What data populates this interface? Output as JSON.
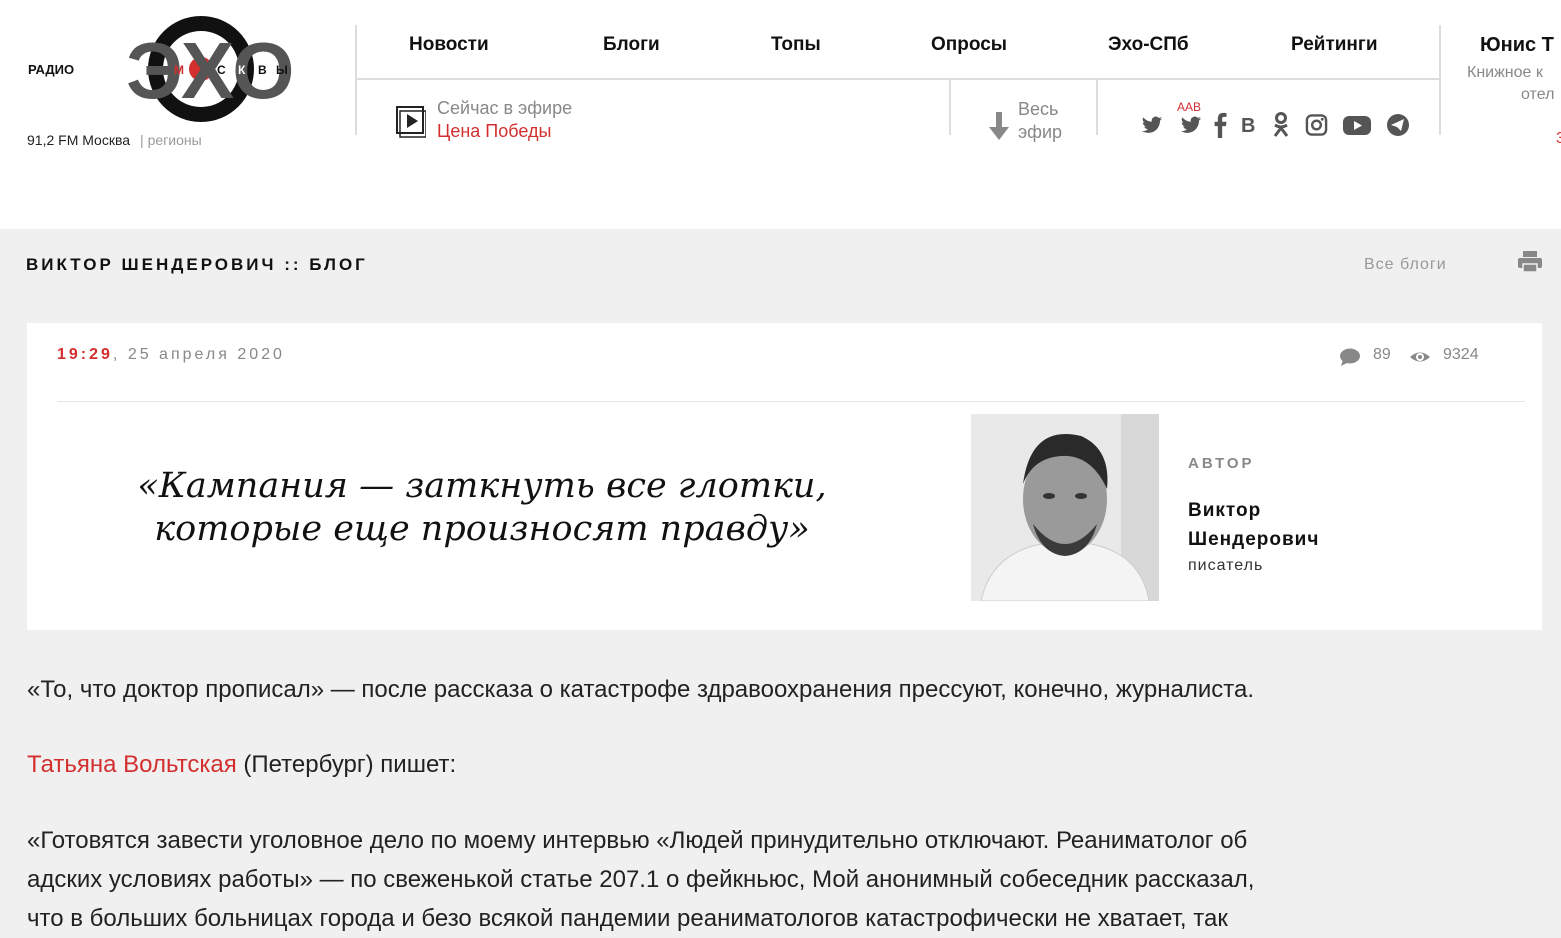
{
  "logo": {
    "text_left": "РАДИО",
    "text_right_1": "М",
    "text_right_2": "С",
    "text_right_3": "К",
    "text_right_4": "В",
    "text_right_5": "Ы",
    "main": "ЭХО"
  },
  "region": {
    "fm": "91,2 FM Москва",
    "regions": "регионы"
  },
  "nav": [
    {
      "label": "Новости"
    },
    {
      "label": "Блоги"
    },
    {
      "label": "Топы"
    },
    {
      "label": "Опросы"
    },
    {
      "label": "Эхо-СПб"
    },
    {
      "label": "Рейтинги"
    }
  ],
  "on_air": {
    "label": "Сейчас в эфире",
    "show": "Цена Победы"
  },
  "all_air": {
    "line1": "Весь",
    "line2": "эфир"
  },
  "social": {
    "aab_label": "AAB",
    "icons": [
      "twitter-icon",
      "twitter-aab-icon",
      "facebook-icon",
      "vk-icon",
      "odnoklassniki-icon",
      "instagram-icon",
      "youtube-icon",
      "telegram-icon"
    ]
  },
  "promo": {
    "name": "Юнис Т",
    "sub1": "Книжное к",
    "sub2": "отел",
    "extra": "3"
  },
  "blog": {
    "title": "ВИКТОР ШЕНДЕРОВИЧ :: БЛОГ",
    "all_blogs": "Все блоги"
  },
  "post": {
    "time": "19:29",
    "date": ", 25 апреля 2020",
    "comments": "89",
    "views": "9324",
    "quote_line1": "«Кампания — заткнуть все глотки,",
    "quote_line2": "которые еще произносят правду»"
  },
  "author": {
    "caption": "АВТОР",
    "name_line1": "Виктор",
    "name_line2": "Шендерович",
    "role": "писатель"
  },
  "body": {
    "p1": "«То, что доктор прописал» — после рассказа о катастрофе здравоохранения прессуют, конечно, журналиста.",
    "p2_link": "Татьяна Вольтская",
    "p2_rest": " (Петербург) пишет:",
    "p3_line1": "«Готовятся завести уголовное дело по моему интервью «Людей принудительно отключают. Реаниматолог об",
    "p3_line2": "адских условиях работы» — по свеженькой статье 207.1 о фейкньюс, Мой анонимный собеседник рассказал,",
    "p3_line3": "что в больших больницах города и безо всякой пандемии реаниматологов катастрофически не хватает, так"
  },
  "colors": {
    "accent": "#d32f2f",
    "bg": "#f0f0f0"
  }
}
